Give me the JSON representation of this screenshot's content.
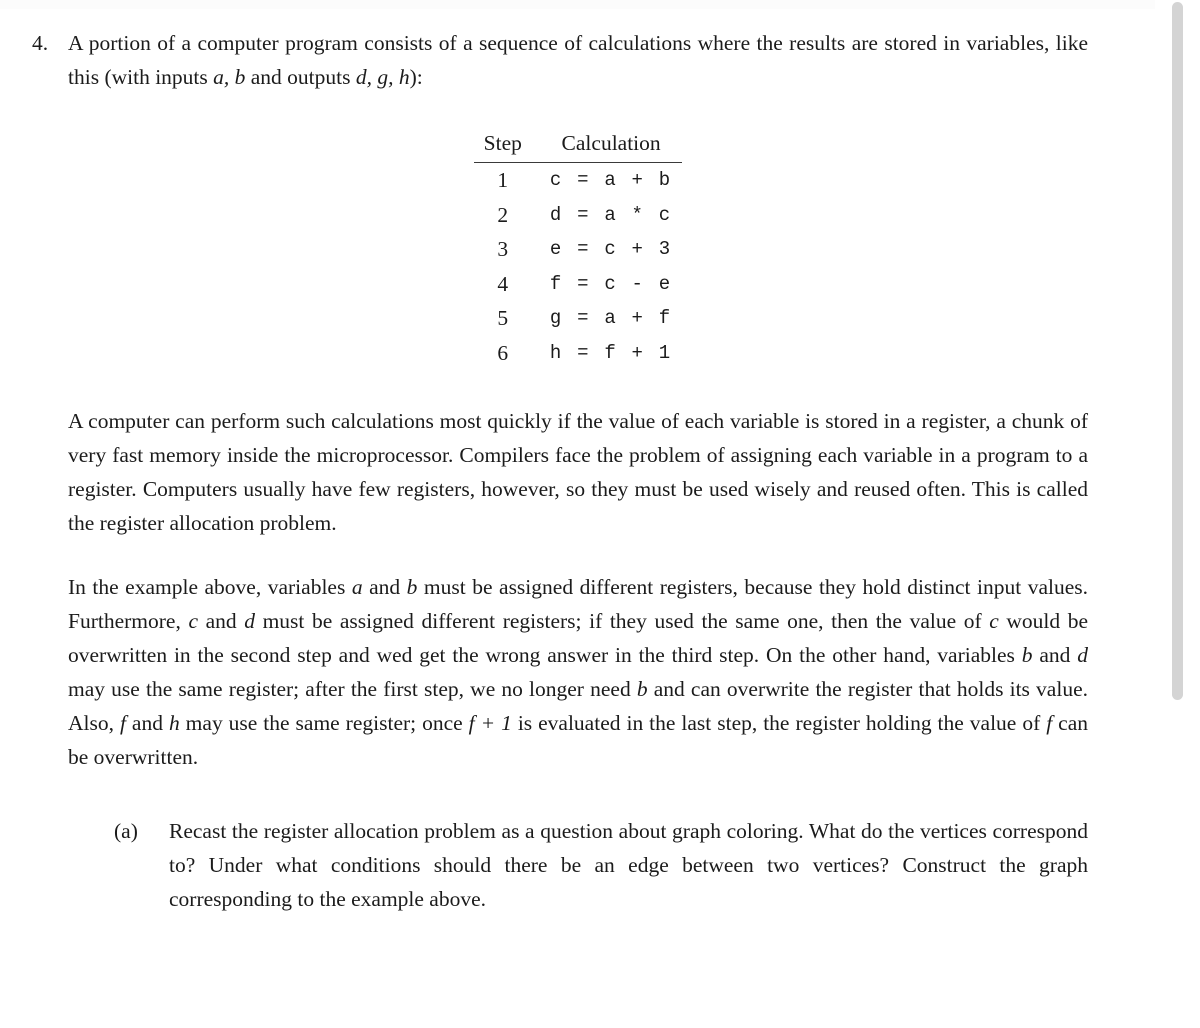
{
  "problem": {
    "marker": "4.",
    "intro_before_vars": "A portion of a computer program consists of a sequence of calculations where the results are stored in variables, like this (with inputs ",
    "intro_inputs": "a, b",
    "intro_middle": " and outputs ",
    "intro_outputs": "d, g, h",
    "intro_after": "):"
  },
  "table": {
    "headers": [
      "Step",
      "Calculation"
    ],
    "rows": [
      {
        "step": "1",
        "calculation": "c = a + b"
      },
      {
        "step": "2",
        "calculation": "d = a * c"
      },
      {
        "step": "3",
        "calculation": "e = c + 3"
      },
      {
        "step": "4",
        "calculation": "f = c - e"
      },
      {
        "step": "5",
        "calculation": "g = a + f"
      },
      {
        "step": "6",
        "calculation": "h = f + 1"
      }
    ]
  },
  "paragraphs": {
    "p1": "A computer can perform such calculations most quickly if the value of each variable is stored in a register, a chunk of very fast memory inside the microprocessor. Compilers face the problem of assigning each variable in a program to a register. Computers usually have few registers, however, so they must be used wisely and reused often. This is called the register allocation problem.",
    "p2_seg1": "In the example above, variables ",
    "p2_var_a": "a",
    "p2_seg2": " and ",
    "p2_var_b": "b",
    "p2_seg3": " must be assigned different registers, because they hold distinct input values. Furthermore, ",
    "p2_var_c": "c",
    "p2_seg4": " and ",
    "p2_var_d": "d",
    "p2_seg5": " must be assigned different registers; if they used the same one, then the value of ",
    "p2_var_c2": "c",
    "p2_seg6": " would be overwritten in the second step and wed get the wrong answer in the third step. On the other hand, variables ",
    "p2_var_b2": "b",
    "p2_seg7": " and ",
    "p2_var_d2": "d",
    "p2_seg8": " may use the same register; after the first step, we no longer need ",
    "p2_var_b3": "b",
    "p2_seg9": " and can overwrite the register that holds its value. Also, ",
    "p2_var_f": "f",
    "p2_seg10": " and ",
    "p2_var_h": "h",
    "p2_seg11": " may use the same register; once ",
    "p2_expr_f1": "f + 1",
    "p2_seg12": " is evaluated in the last step, the register holding the value of ",
    "p2_var_f2": "f",
    "p2_seg13": " can be overwritten."
  },
  "subproblem": {
    "marker": "(a)",
    "text": "Recast the register allocation problem as a question about graph coloring. What do the vertices correspond to? Under what conditions should there be an edge between two vertices? Construct the graph corresponding to the example above."
  },
  "colors": {
    "text": "#1b1b1b",
    "page_background": "#ffffff",
    "rule": "#3a3a3a",
    "scrollbar_thumb": "#d4d4d4"
  }
}
